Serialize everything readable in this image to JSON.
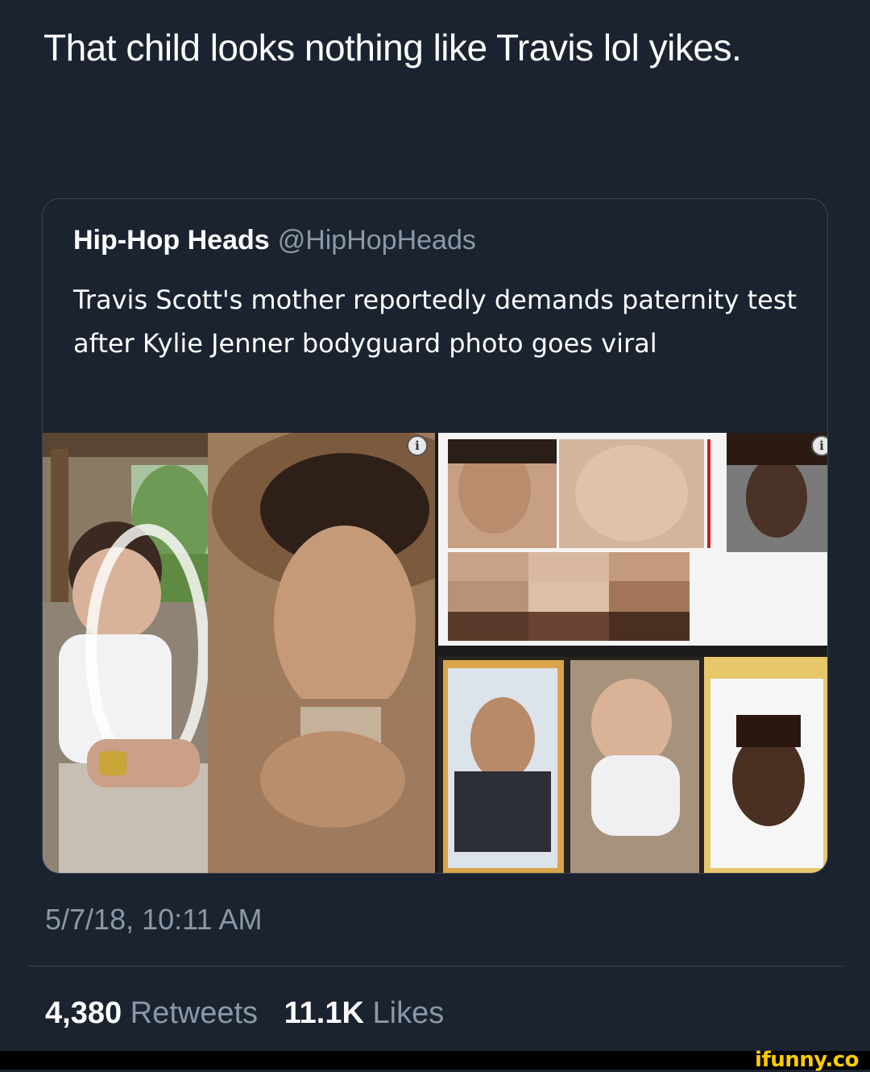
{
  "tweet": {
    "text": "That child looks nothing like Travis lol yikes."
  },
  "quoted_tweet": {
    "display_name": "Hip-Hop Heads",
    "handle": "@HipHopHeads",
    "text": "Travis Scott's mother reportedly demands paternity test after Kylie Jenner bodyguard photo goes viral"
  },
  "timestamp": "5/7/18, 10:11 AM",
  "stats": {
    "retweets_count": "4,380",
    "retweets_label": "Retweets",
    "likes_count": "11.1K",
    "likes_label": "Likes"
  },
  "watermark": "ifunny.co",
  "icons": {
    "info": "info-icon"
  },
  "colors": {
    "background": "#1b2330",
    "secondary_text": "#8b98a5",
    "watermark": "#ffcc00"
  }
}
